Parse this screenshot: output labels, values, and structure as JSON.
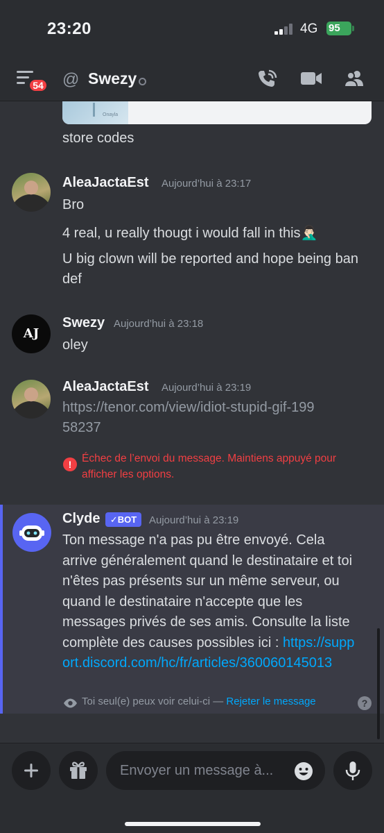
{
  "status_bar": {
    "time": "23:20",
    "network": "4G",
    "battery": "95"
  },
  "header": {
    "unread_badge": "54",
    "at_symbol": "@",
    "channel_name": "Swezy",
    "icons": [
      "menu-icon",
      "at-icon",
      "phone-call-icon",
      "video-call-icon",
      "members-icon"
    ]
  },
  "attachment": {
    "thumb_caption": "Onayla"
  },
  "messages": [
    {
      "continuation": "store codes"
    },
    {
      "author": "AleaJactaEst",
      "timestamp": "Aujourd’hui à 23:17",
      "lines": [
        "Bro",
        "4 real, u really thougt i would fall in this🤦🏻‍♂️",
        "U big clown will be reported and hope being ban def"
      ]
    },
    {
      "author": "Swezy",
      "timestamp": "Aujourd’hui à 23:18",
      "avatar_text": "AJ",
      "lines": [
        "oley"
      ]
    },
    {
      "author": "AleaJactaEst",
      "timestamp": "Aujourd’hui à 23:19",
      "link": "https://tenor.com/view/idiot-stupid-gif-19958237",
      "error": "Échec de l’envoi du message. Maintiens appuyé pour afficher les options."
    }
  ],
  "clyde": {
    "author": "Clyde",
    "bot_label": "BOT",
    "timestamp": "Aujourd’hui à 23:19",
    "body": "Ton message n'a pas pu être envoyé. Cela arrive généralement quand le destinataire et toi n'êtes pas présents sur un même serveur, ou quand le destinataire n'accepte que les messages privés de ses amis. Consulte la liste complète des causes possibles ici : ",
    "link": "https://support.discord.com/hc/fr/articles/360060145013",
    "only_you": "Toi seul(e) peux voir celui-ci — ",
    "dismiss": "Rejeter le message",
    "help": "?"
  },
  "composer": {
    "placeholder": "Envoyer un message à...",
    "icons": [
      "plus-icon",
      "gift-icon",
      "emoji-icon",
      "microphone-icon"
    ]
  },
  "colors": {
    "background": "#313338",
    "header": "#2b2d31",
    "blurple": "#5865f2",
    "error": "#f23f43",
    "link": "#00a8fc",
    "battery": "#3ba55c"
  }
}
